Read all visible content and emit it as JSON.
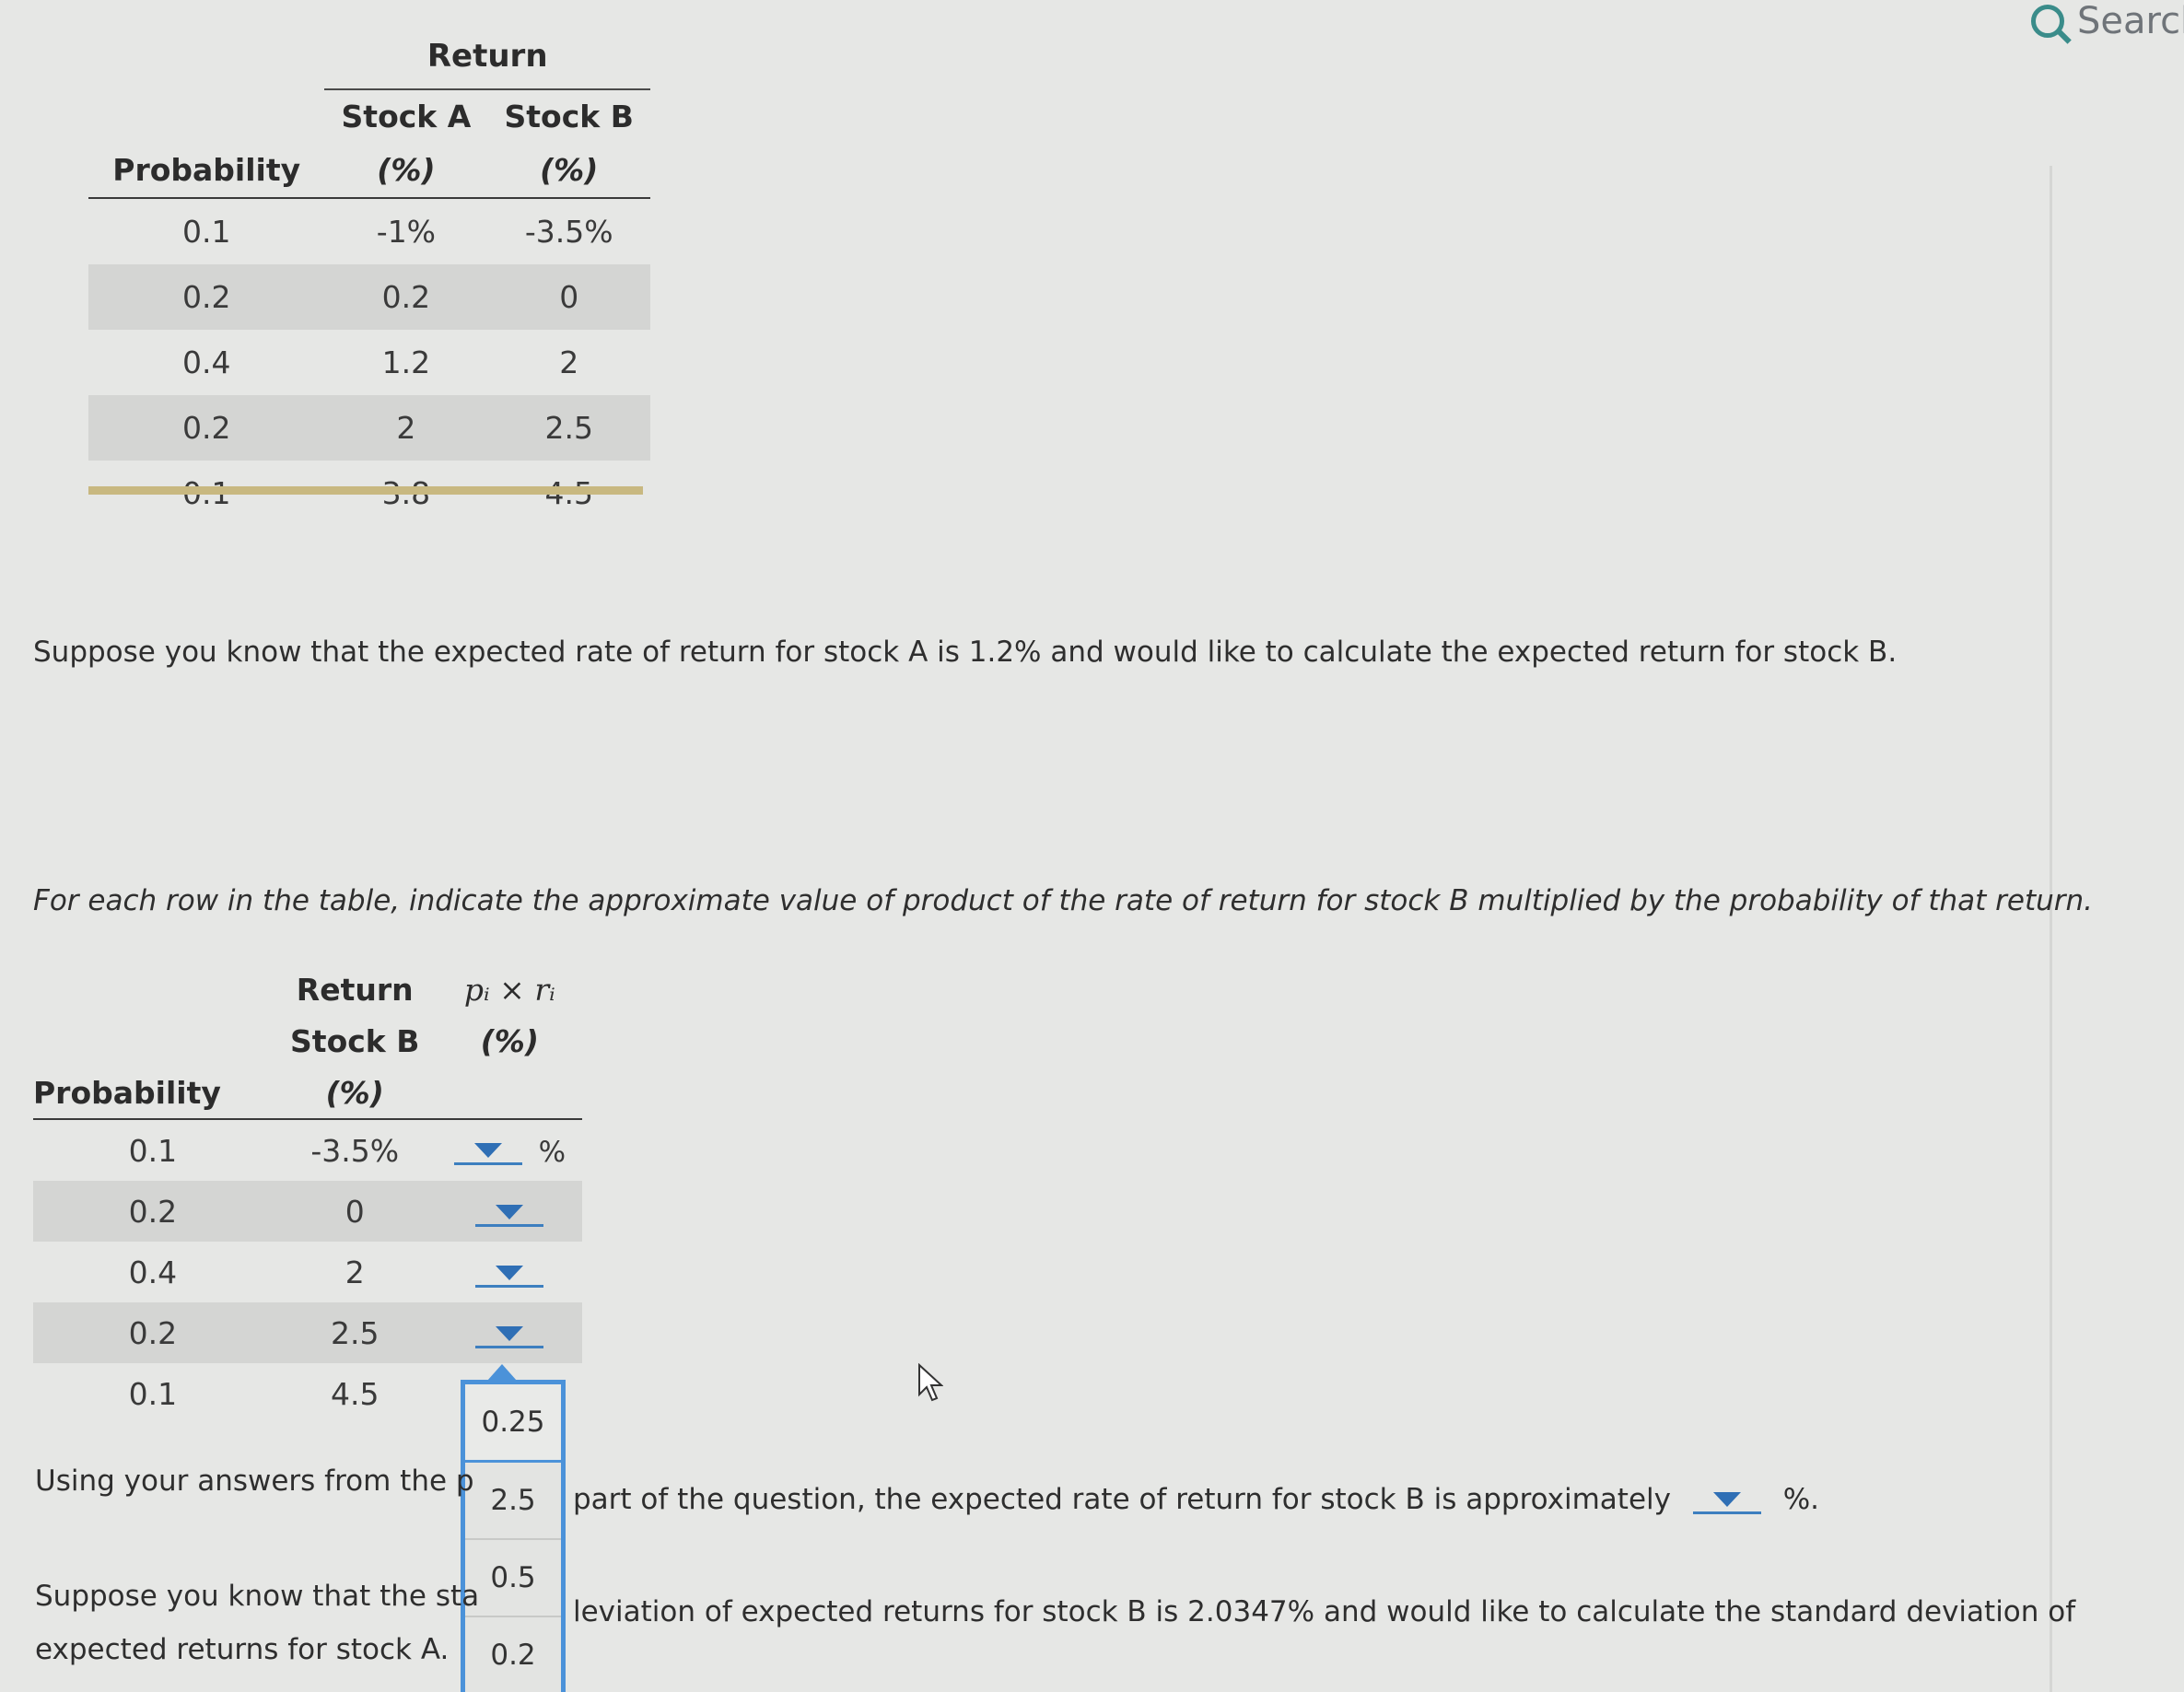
{
  "search": {
    "label": "Search"
  },
  "table1": {
    "group_header": "Return",
    "col_probability": "Probability",
    "col_stock_a": "Stock A",
    "col_stock_b": "Stock B",
    "unit": "(%)",
    "rows": [
      {
        "p": "0.1",
        "a": "-1%",
        "b": "-3.5%"
      },
      {
        "p": "0.2",
        "a": "0.2",
        "b": "0"
      },
      {
        "p": "0.4",
        "a": "1.2",
        "b": "2"
      },
      {
        "p": "0.2",
        "a": "2",
        "b": "2.5"
      },
      {
        "p": "0.1",
        "a": "3.8",
        "b": "4.5"
      }
    ]
  },
  "text": {
    "suppose_expected": "Suppose you know that the expected rate of return for stock A is 1.2% and would like to calculate the expected return for stock B.",
    "instruction": "For each row in the table, indicate the approximate value of product of the rate of return for stock B multiplied by the probability of that return.",
    "using_answers_start": "Using your answers from the p",
    "using_answers_end": "part of the question, the expected rate of return for stock B is approximately",
    "percent_period": "%.",
    "suppose_std_start": "Suppose you know that the sta",
    "suppose_std_end": "leviation of expected returns for stock B is 2.0347% and would like to calculate the standard deviation of",
    "expected_a": "expected returns for stock A."
  },
  "table2": {
    "group_header": "Return",
    "col_stock_b": "Stock B",
    "col_probability": "Probability",
    "formula_header": "pᵢ × rᵢ",
    "unit": "(%)",
    "pct_suffix": "%",
    "rows": [
      {
        "p": "0.1",
        "b": "-3.5%"
      },
      {
        "p": "0.2",
        "b": "0"
      },
      {
        "p": "0.4",
        "b": "2"
      },
      {
        "p": "0.2",
        "b": "2.5"
      },
      {
        "p": "0.1",
        "b": "4.5"
      }
    ]
  },
  "dropdown_options": [
    "0.25",
    "2.5",
    "0.5",
    "0.2"
  ]
}
